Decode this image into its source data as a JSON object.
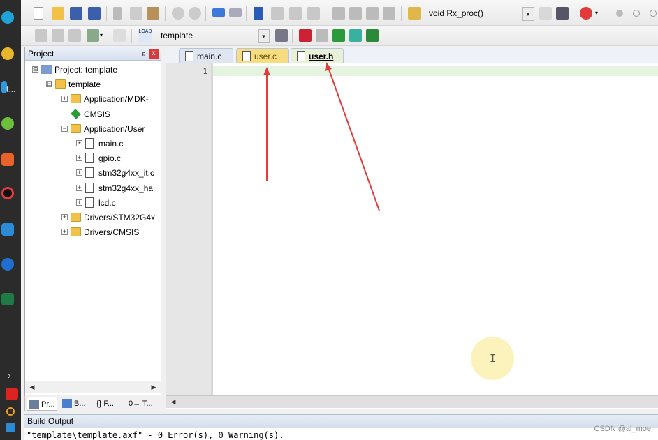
{
  "taskbar": {
    "icons": [
      "edge-icon",
      "chrome-icon",
      "app-icon",
      "clover-icon",
      "orange-app-icon",
      "record-icon",
      "blue-app-icon",
      "cursor-app-icon",
      "excel-icon",
      "chevron-right-icon",
      "red-app-icon",
      "search-icon",
      "settings-icon"
    ],
    "text": "t..."
  },
  "toolbar1": {
    "function_combo": "void Rx_proc()"
  },
  "toolbar2": {
    "target_combo": "template",
    "load_label": "LOAD"
  },
  "project_panel": {
    "title": "Project",
    "pin": "ᵖ",
    "close": "x",
    "tree": [
      {
        "label": "Project: template",
        "kind": "project",
        "expander": "⊟",
        "depth": 0
      },
      {
        "label": "template",
        "kind": "target",
        "expander": "⊟",
        "depth": 1
      },
      {
        "label": "Application/MDK-",
        "kind": "folder",
        "expander": "+",
        "depth": 2
      },
      {
        "label": "CMSIS",
        "kind": "component",
        "expander": "",
        "depth": 2
      },
      {
        "label": "Application/User",
        "kind": "folder-open",
        "expander": "−",
        "depth": 2
      },
      {
        "label": "main.c",
        "kind": "file",
        "expander": "+",
        "depth": 3
      },
      {
        "label": "gpio.c",
        "kind": "file",
        "expander": "+",
        "depth": 3
      },
      {
        "label": "stm32g4xx_it.c",
        "kind": "file",
        "expander": "+",
        "depth": 3
      },
      {
        "label": "stm32g4xx_ha",
        "kind": "file",
        "expander": "+",
        "depth": 3
      },
      {
        "label": "lcd.c",
        "kind": "file",
        "expander": "+",
        "depth": 3
      },
      {
        "label": "Drivers/STM32G4x",
        "kind": "folder",
        "expander": "+",
        "depth": 2
      },
      {
        "label": "Drivers/CMSIS",
        "kind": "folder",
        "expander": "+",
        "depth": 2
      }
    ],
    "tabs": [
      "Pr...",
      "B...",
      "{} F...",
      "0→ T..."
    ]
  },
  "editor": {
    "tabs": [
      {
        "label": "main.c",
        "state": "inactive"
      },
      {
        "label": "user.c",
        "state": "modified"
      },
      {
        "label": "user.h",
        "state": "active"
      }
    ],
    "line_number": "1"
  },
  "build_output": {
    "title": "Build Output",
    "text": "\"template\\template.axf\" - 0 Error(s), 0 Warning(s)."
  },
  "watermark": "CSDN @al_moe",
  "colors": {
    "arrow": "#e23b3b",
    "modified_tab": "#f8dc82",
    "current_line": "#e4f4e0"
  }
}
